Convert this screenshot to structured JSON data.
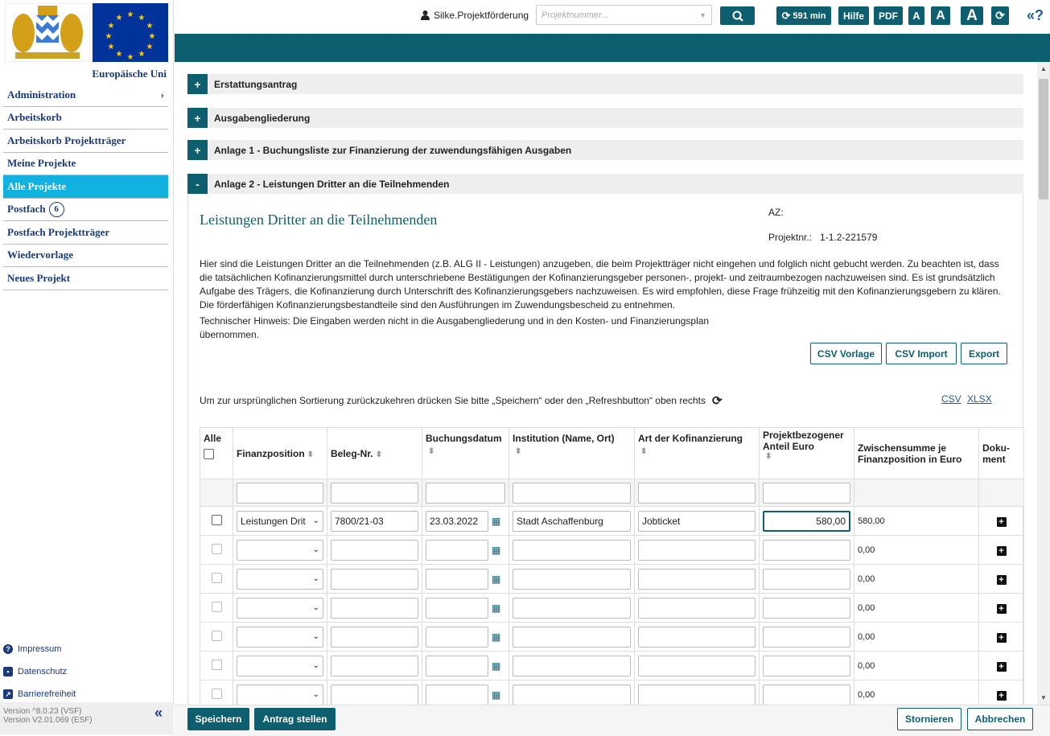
{
  "sidebar": {
    "eu_label": "Europäische Uni",
    "items": [
      {
        "label": "Administration",
        "chevron": "›"
      },
      {
        "label": "Arbeitskorb"
      },
      {
        "label": "Arbeitskorb Projektträger"
      },
      {
        "label": "Meine Projekte"
      },
      {
        "label": "Alle Projekte",
        "active": true
      },
      {
        "label": "Postfach",
        "badge": "6"
      },
      {
        "label": "Postfach Projektträger"
      },
      {
        "label": "Wiedervorlage"
      },
      {
        "label": "Neues Projekt"
      }
    ],
    "footer_links": [
      {
        "label": "Impressum",
        "icon": "help-icon",
        "glyph": "?"
      },
      {
        "label": "Datenschutz",
        "icon": "privacy-icon",
        "glyph": "▪"
      },
      {
        "label": "Barrierefreiheit",
        "icon": "accessibility-icon",
        "glyph": "↗"
      }
    ],
    "version1": "Version ^8.0.23 (VSF)",
    "version2": "Version V2.01.069 (ESF)",
    "collapse": "«"
  },
  "topbar": {
    "user": "Silke.Projektförderung",
    "project_placeholder": "Projektnummer...",
    "timer": "591 min",
    "help": "Hilfe",
    "pdf": "PDF",
    "font_small": "A",
    "font_medium": "A",
    "font_large": "A",
    "help_q": "«?"
  },
  "accordion": [
    {
      "label": "Erstattungsantrag",
      "sign": "+"
    },
    {
      "label": "Ausgabengliederung",
      "sign": "+"
    },
    {
      "label": "Anlage 1 - Buchungsliste zur Finanzierung der zuwendungsfähigen Ausgaben",
      "sign": "+"
    },
    {
      "label": "Anlage 2 - Leistungen Dritter an die Teilnehmenden",
      "sign": "-"
    }
  ],
  "panel": {
    "title": "Leistungen Dritter an die Teilnehmenden",
    "az_label": "AZ:",
    "projnr_label": "Projektnr.:",
    "projnr_value": "1-1.2-221579",
    "description": "Hier sind die Leistungen Dritter an die Teilnehmenden (z.B. ALG II - Leistungen) anzugeben, die beim Projektträger nicht eingehen und folglich nicht gebucht werden. Zu beachten ist, dass die tatsächlichen Kofinanzierungsmittel durch unterschriebene Bestätigungen der Kofinanzierungsgeber personen-, projekt- und zeitraumbezogen nachzuweisen sind. Es ist grundsätzlich Aufgabe des Trägers, die Kofinanzierung durch Unterschrift des Kofinanzierungsgebers nachzuweisen. Es wird empfohlen, diese Frage frühzeitig mit den Kofinanzierungsgebern zu klären. Die förderfähigen Kofinanzierungsbestandteile sind den Ausführungen im Zuwendungsbescheid zu entnehmen.",
    "hint": "Technischer Hinweis: Die Eingaben werden nicht in die Ausgabengliederung und in den Kosten- und Finanzierungsplan übernommen.",
    "csv_template": "CSV Vorlage",
    "csv_import": "CSV Import",
    "export": "Export",
    "sort_note": "Um zur ursprünglichen Sortierung zurückzukehren drücken Sie bitte „Speichern“ oder den „Refreshbutton“ oben rechts",
    "dl_csv": "CSV",
    "dl_xlsx": "XLSX"
  },
  "table": {
    "headers": {
      "all": "Alle",
      "finanzposition": "Finanzposition",
      "beleg": "Beleg-Nr.",
      "buchungsdatum": "Buchungsdatum",
      "institution": "Institution (Name, Ort)",
      "art": "Art der Kofinanzierung",
      "anteil": "Projektbezogener Anteil Euro",
      "zwischensumme": "Zwischensumme je Finanzposition in Euro",
      "dokument": "Doku-ment"
    },
    "rows": [
      {
        "finanzposition": "Leistungen Drit",
        "beleg": "7800/21-03",
        "datum": "23.03.2022",
        "institution": "Stadt Aschaffenburg",
        "art": "Jobticket",
        "anteil": "580,00",
        "summe": "580,00"
      },
      {
        "finanzposition": "",
        "beleg": "",
        "datum": "",
        "institution": "",
        "art": "",
        "anteil": "",
        "summe": "0,00"
      },
      {
        "finanzposition": "",
        "beleg": "",
        "datum": "",
        "institution": "",
        "art": "",
        "anteil": "",
        "summe": "0,00"
      },
      {
        "finanzposition": "",
        "beleg": "",
        "datum": "",
        "institution": "",
        "art": "",
        "anteil": "",
        "summe": "0,00"
      },
      {
        "finanzposition": "",
        "beleg": "",
        "datum": "",
        "institution": "",
        "art": "",
        "anteil": "",
        "summe": "0,00"
      },
      {
        "finanzposition": "",
        "beleg": "",
        "datum": "",
        "institution": "",
        "art": "",
        "anteil": "",
        "summe": "0,00"
      },
      {
        "finanzposition": "",
        "beleg": "",
        "datum": "",
        "institution": "",
        "art": "",
        "anteil": "",
        "summe": "0,00"
      }
    ]
  },
  "footer": {
    "save": "Speichern",
    "submit": "Antrag stellen",
    "cancel": "Stornieren",
    "abort": "Abbrechen"
  },
  "colors": {
    "primary": "#0d5e6f",
    "active_nav": "#11b2e0",
    "link": "#1a3b7a"
  }
}
